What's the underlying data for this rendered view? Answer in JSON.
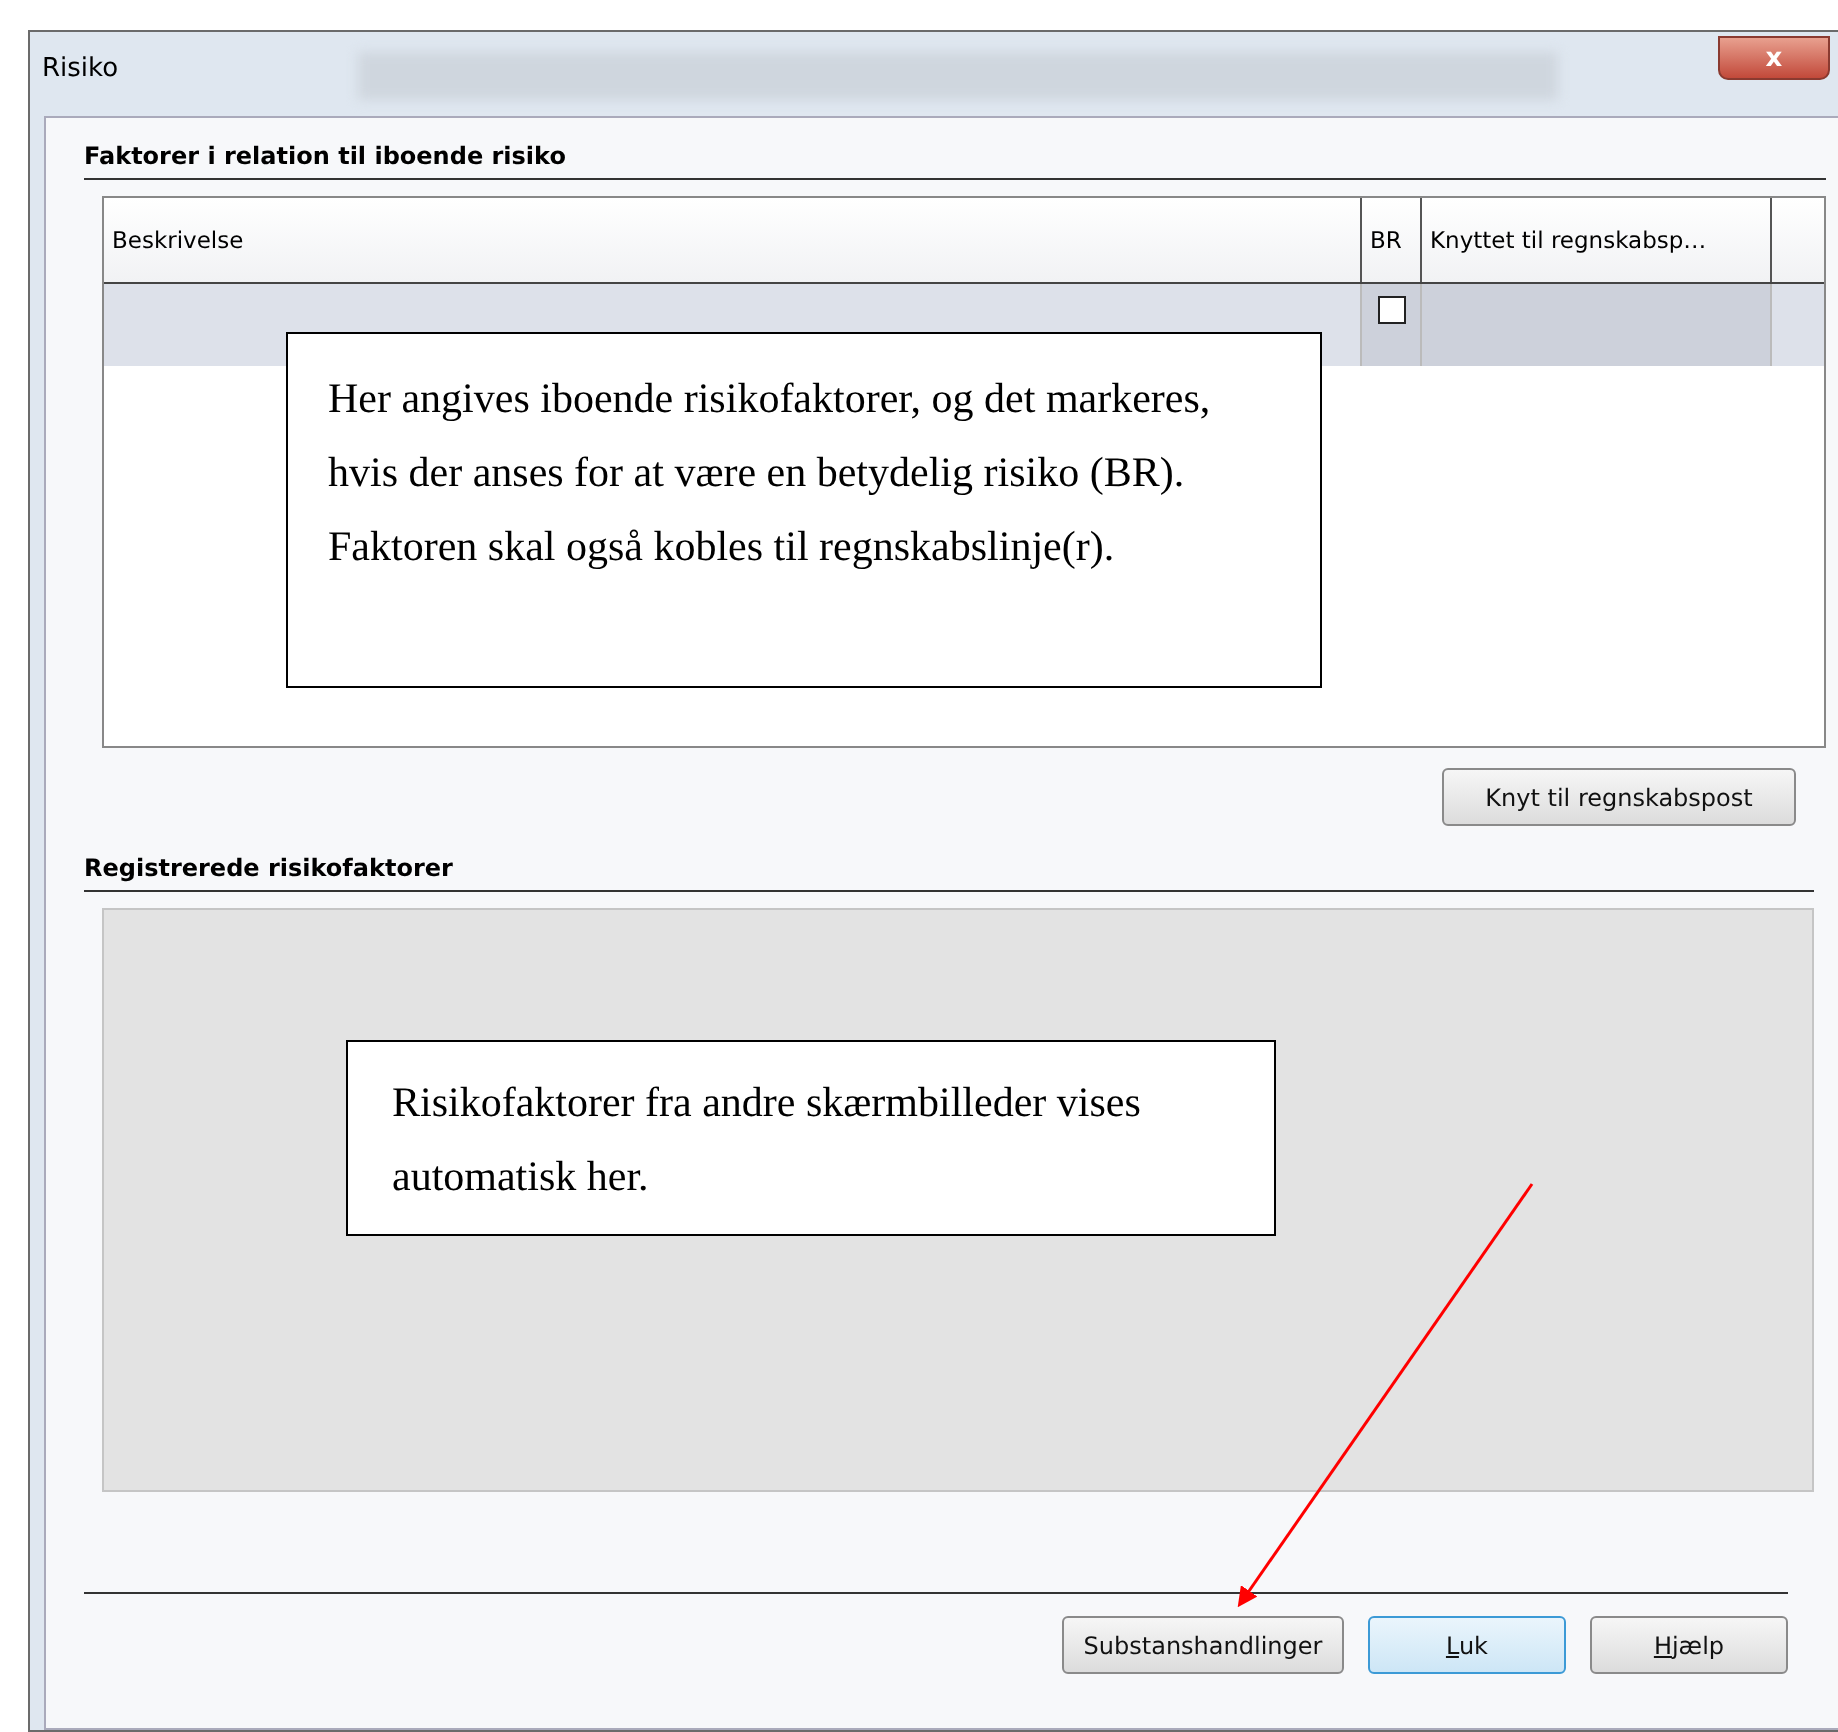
{
  "window": {
    "title": "Risiko",
    "close_label": "x"
  },
  "section_1": {
    "title": "Faktorer i relation til iboende risiko",
    "table": {
      "columns": [
        "Beskrivelse",
        "BR",
        "Knyttet til regnskabsp…"
      ],
      "rows": [
        {
          "selected": true,
          "br_checked": false
        }
      ]
    },
    "callout": "Her angives iboende risikofaktorer, og det markeres, hvis der anses for at være en betydelig risiko (BR). Faktoren skal også kobles til regnskabslinje(r).",
    "button": "Knyt til regnskabspost"
  },
  "section_2": {
    "title": "Registrerede risikofaktorer",
    "callout": "Risikofaktorer fra andre skærmbilleder vises automatisk her."
  },
  "buttons": [
    {
      "label": "Substanshandlinger",
      "mnemonic": false,
      "default": false
    },
    {
      "label": "Luk",
      "mnemonic": true,
      "default": true
    },
    {
      "label": "Hjælp",
      "mnemonic": true,
      "default": false
    }
  ]
}
